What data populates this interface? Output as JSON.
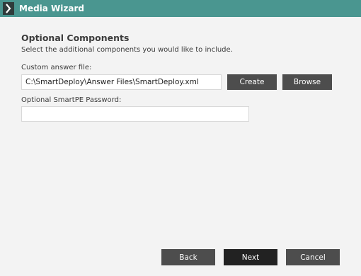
{
  "window": {
    "title": "Media Wizard",
    "icon": "chevron-right-icon"
  },
  "page": {
    "section_title": "Optional Components",
    "section_subtitle": "Select the additional components you would like to include."
  },
  "answer_file": {
    "label": "Custom answer file:",
    "value": "C:\\SmartDeploy\\Answer Files\\SmartDeploy.xml",
    "create_label": "Create",
    "browse_label": "Browse"
  },
  "password": {
    "label": "Optional SmartPE Password:",
    "value": ""
  },
  "footer": {
    "back_label": "Back",
    "next_label": "Next",
    "cancel_label": "Cancel"
  },
  "colors": {
    "titlebar": "#4a9690",
    "button": "#4d4d4d",
    "primary_button": "#222222",
    "background": "#f3f3f3"
  }
}
